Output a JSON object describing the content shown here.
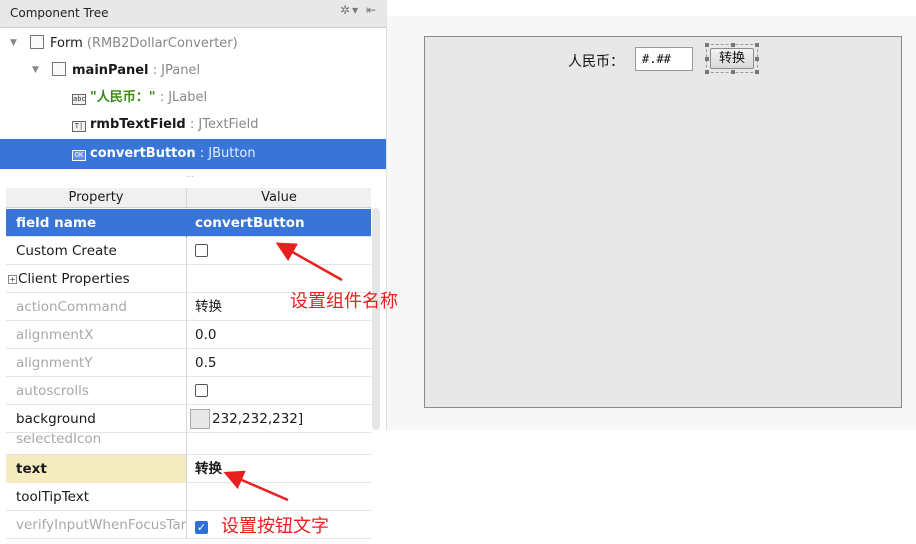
{
  "component_tree": {
    "title": "Component Tree",
    "tools": "✲▾ ⇤",
    "nodes": [
      {
        "name": "Form",
        "type": "(RMB2DollarConverter)"
      },
      {
        "name": "mainPanel",
        "type": ": JPanel"
      },
      {
        "name": "\"人民币：\"",
        "type": ": JLabel"
      },
      {
        "name": "rmbTextField",
        "type": ": JTextField"
      },
      {
        "name": "convertButton",
        "type": ": JButton"
      }
    ]
  },
  "properties": {
    "header": {
      "property": "Property",
      "value": "Value"
    },
    "rows": [
      {
        "name": "field name",
        "value": "convertButton"
      },
      {
        "name": "Custom Create",
        "value": ""
      },
      {
        "name": "Client Properties",
        "value": ""
      },
      {
        "name": "actionCommand",
        "value": "转换"
      },
      {
        "name": "alignmentX",
        "value": "0.0"
      },
      {
        "name": "alignmentY",
        "value": "0.5"
      },
      {
        "name": "autoscrolls",
        "value": ""
      },
      {
        "name": "background",
        "value": "232,232,232]"
      },
      {
        "name": "selectedIcon",
        "value": ""
      },
      {
        "name": "text",
        "value": "转换"
      },
      {
        "name": "toolTipText",
        "value": ""
      },
      {
        "name": "verifyInputWhenFocusTar",
        "value": ""
      }
    ]
  },
  "annotations": {
    "name_note": "设置组件名称",
    "text_note": "设置按钮文字"
  },
  "designer": {
    "label": "人民币：",
    "field": "#.##",
    "button": "转换"
  },
  "colors": {
    "selection": "#3875d7",
    "annotation": "#e8201f",
    "canvas": "#e8e8e8"
  }
}
